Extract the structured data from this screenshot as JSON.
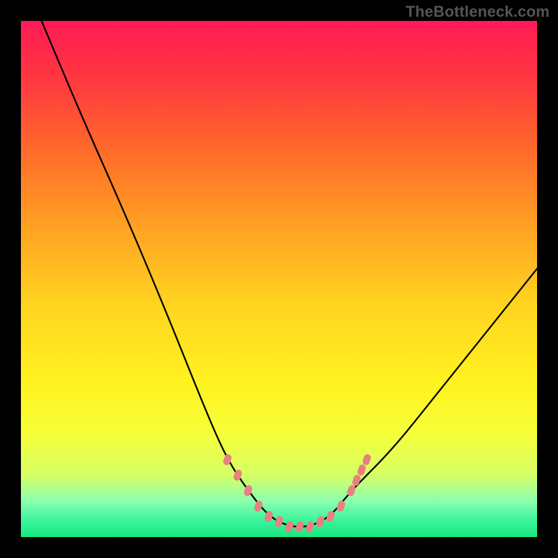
{
  "watermark": "TheBottleneck.com",
  "chart_data": {
    "type": "line",
    "title": "",
    "xlabel": "",
    "ylabel": "",
    "xlim": [
      0,
      100
    ],
    "ylim": [
      0,
      100
    ],
    "series": [
      {
        "name": "curve",
        "x": [
          4,
          12,
          20,
          28,
          36,
          40,
          44,
          48,
          52,
          56,
          60,
          64,
          72,
          80,
          88,
          96,
          100
        ],
        "values": [
          100,
          81,
          63,
          44,
          24,
          15,
          9,
          4,
          2,
          2,
          4,
          9,
          17,
          27,
          37,
          47,
          52
        ]
      }
    ],
    "annotations": {
      "marker_color": "#e98080",
      "markers_x": [
        40,
        42,
        44,
        46,
        48,
        50,
        52,
        54,
        56,
        58,
        60,
        62,
        64,
        65,
        66,
        67
      ],
      "markers_values": [
        15,
        12,
        9,
        6,
        4,
        3,
        2,
        2,
        2,
        3,
        4,
        6,
        9,
        11,
        13,
        15
      ]
    }
  }
}
